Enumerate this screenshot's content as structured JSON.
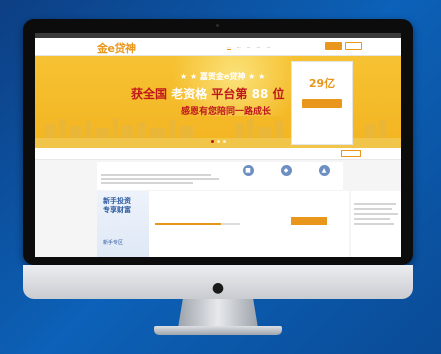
{
  "site": {
    "logo": "金e贷神",
    "slogan": "",
    "nav": [
      "...",
      "...",
      "...",
      "...",
      "..."
    ],
    "login_label": "",
    "register_label": ""
  },
  "banner": {
    "stars_title": "★ ★ 嘉贺金e贷神 ★ ★",
    "main_title_a": "获全国",
    "main_title_hl": "老资格",
    "main_title_b": "平台第",
    "main_title_num": "88",
    "main_title_c": "位",
    "sub_title": "感恩有您陪同一路成长",
    "slides": 3,
    "active_slide": 0
  },
  "promo": {
    "label": "",
    "value": "29亿",
    "note": "",
    "button": "",
    "footer": ""
  },
  "stats": [
    {
      "label": "",
      "value": ""
    },
    {
      "label": "",
      "value": ""
    },
    {
      "label": "",
      "value": ""
    }
  ],
  "stats_button": "",
  "notice": {
    "title": "",
    "features": [
      {
        "icon": "building-icon",
        "label": ""
      },
      {
        "icon": "shield-icon",
        "label": ""
      },
      {
        "icon": "chart-icon",
        "label": ""
      }
    ]
  },
  "product": {
    "tag_line1": "新手投资",
    "tag_line2": "专享财富",
    "tag_footer": "新手专区",
    "name": "",
    "rate": "",
    "progress": 0.78,
    "buy_button": ""
  },
  "side": {
    "title": ""
  },
  "colors": {
    "accent": "#e9971c",
    "banner_yellow": "#f6c233",
    "brand_red": "#c0171d",
    "brand_blue": "#2c5aa0"
  }
}
